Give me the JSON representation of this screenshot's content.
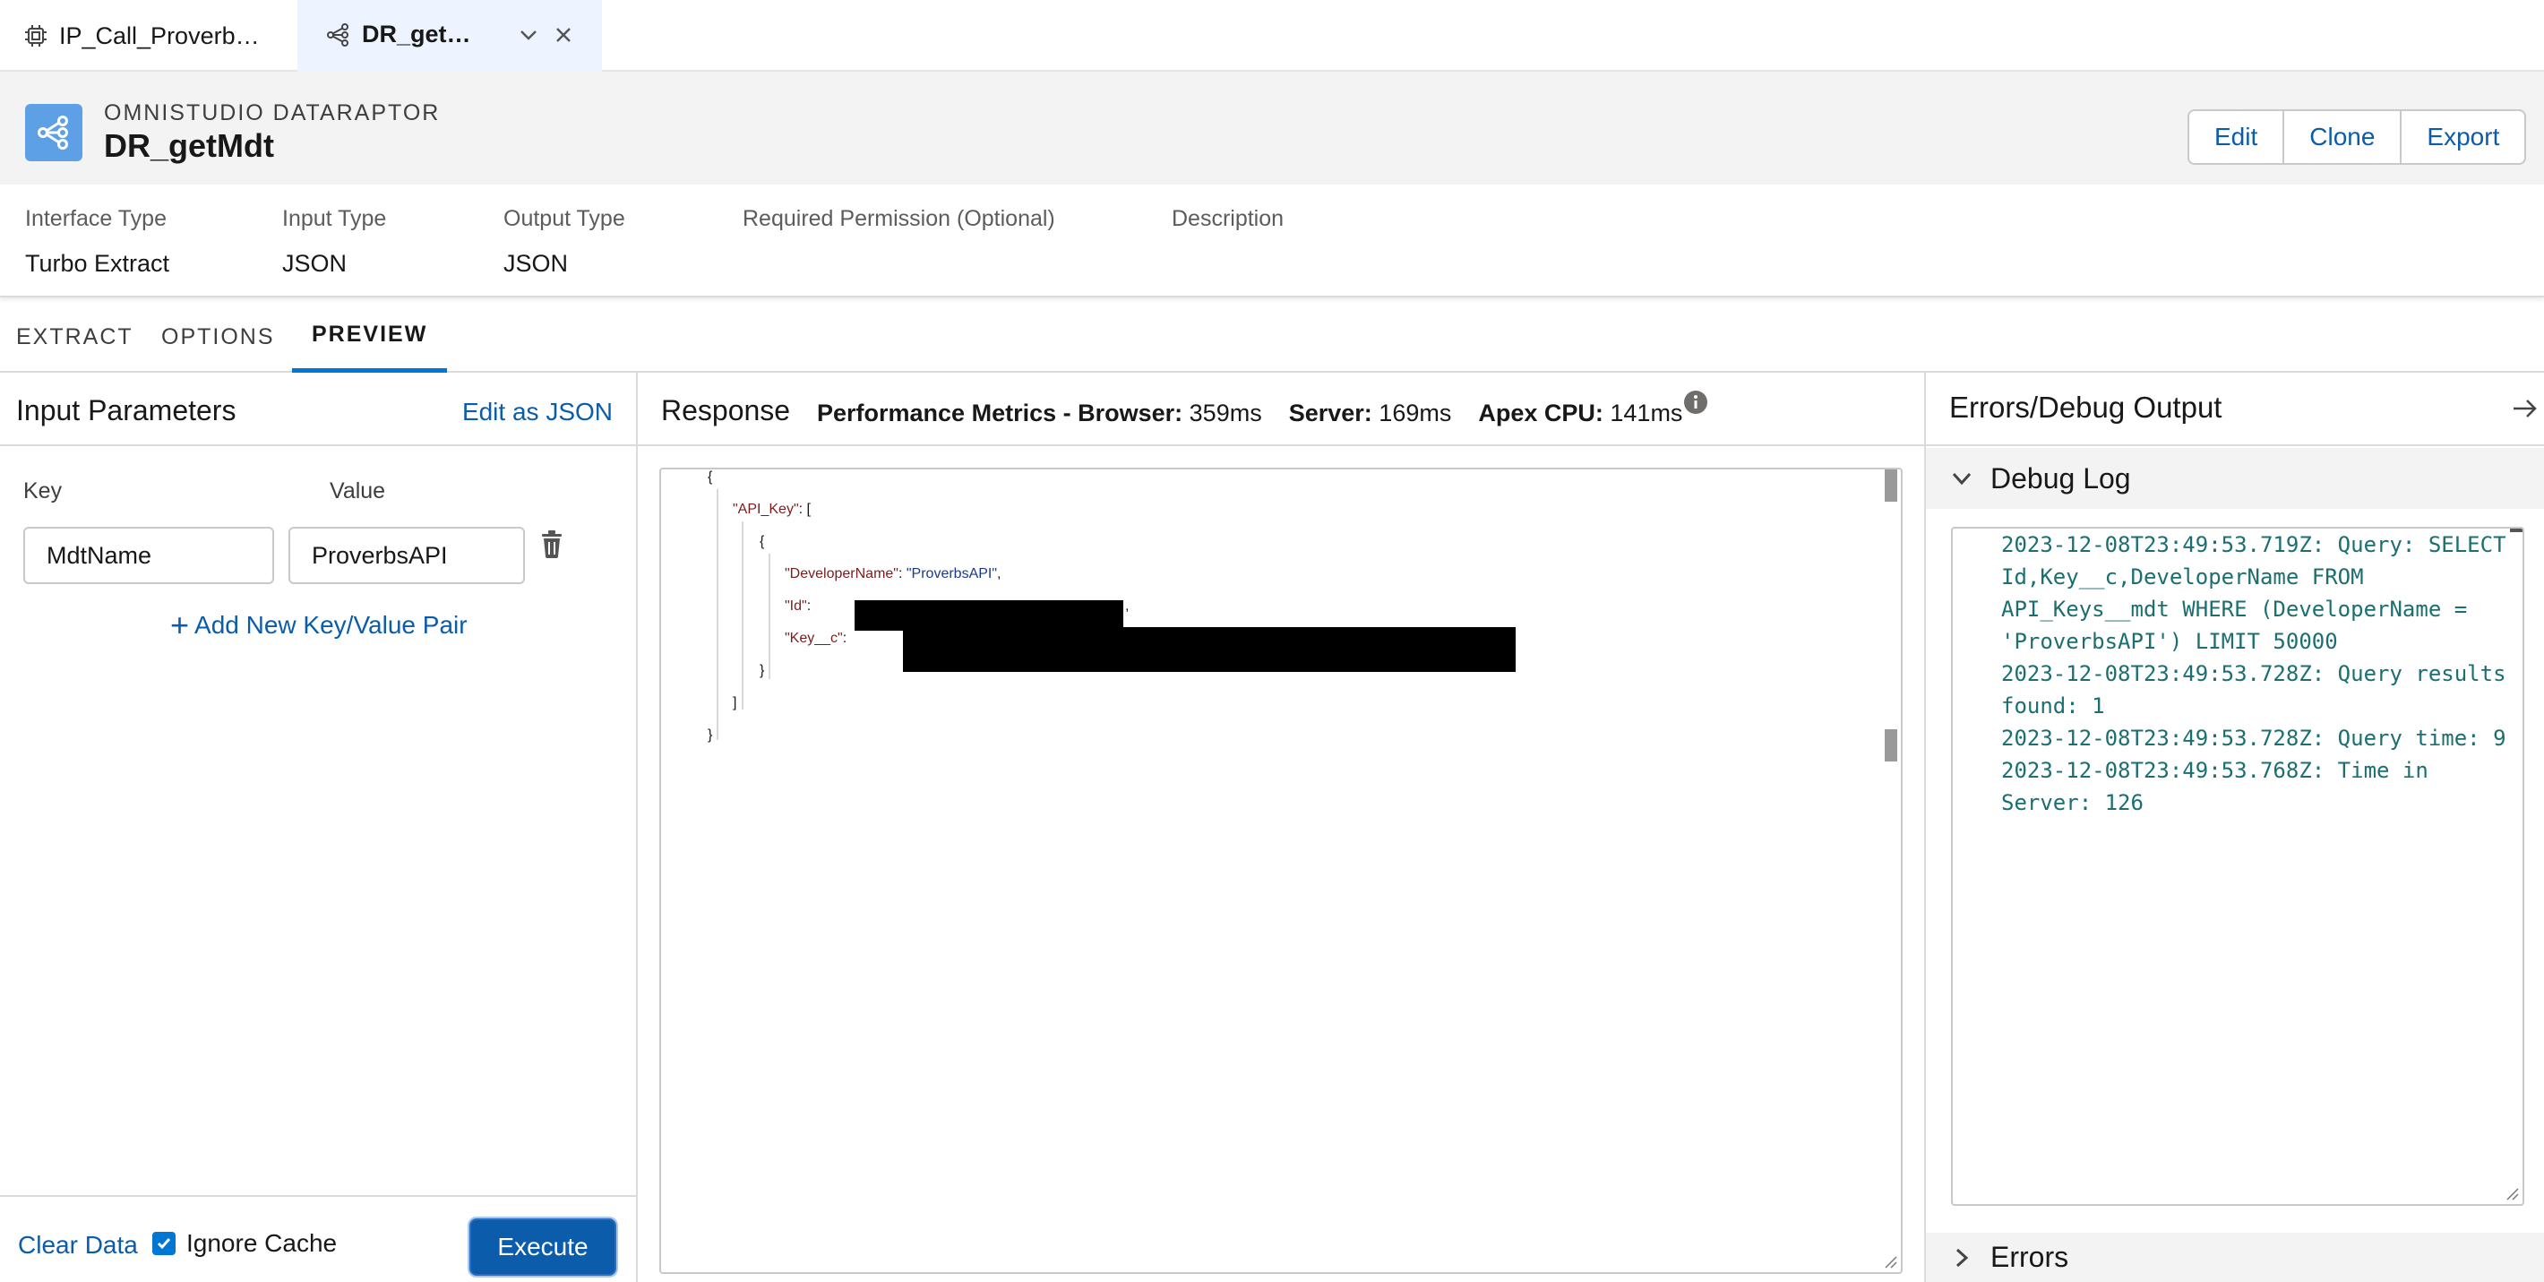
{
  "tabs": [
    {
      "label": "IP_Call_Proverb…",
      "icon": "chip-icon"
    },
    {
      "label": "DR_get…",
      "icon": "share-nodes-icon"
    }
  ],
  "record": {
    "kicker": "OMNISTUDIO DATARAPTOR",
    "title": "DR_getMdt",
    "actions": {
      "edit": "Edit",
      "clone": "Clone",
      "export": "Export"
    }
  },
  "fields": {
    "interface_type": {
      "label": "Interface Type",
      "value": "Turbo Extract"
    },
    "input_type": {
      "label": "Input Type",
      "value": "JSON"
    },
    "output_type": {
      "label": "Output Type",
      "value": "JSON"
    },
    "required_permission": {
      "label": "Required Permission (Optional)",
      "value": ""
    },
    "description": {
      "label": "Description",
      "value": ""
    }
  },
  "subtabs": {
    "extract": "EXTRACT",
    "options": "OPTIONS",
    "preview": "PREVIEW",
    "active": "PREVIEW"
  },
  "input_params": {
    "title": "Input Parameters",
    "edit_json": "Edit as JSON",
    "key_header": "Key",
    "value_header": "Value",
    "rows": [
      {
        "key": "MdtName",
        "value": "ProverbsAPI"
      }
    ],
    "add_pair": "Add New Key/Value Pair",
    "clear_data": "Clear Data",
    "ignore_cache_label": "Ignore Cache",
    "ignore_cache_checked": true,
    "execute": "Execute"
  },
  "response": {
    "title": "Response",
    "metrics_label": "Performance Metrics - Browser:",
    "browser_ms": "359ms",
    "server_label": "Server:",
    "server_ms": "169ms",
    "apex_label": "Apex CPU:",
    "apex_ms": "141ms",
    "json": {
      "open": "{",
      "api_key_key": "\"API_Key\"",
      "api_key_open": ": [",
      "obj_open": "{",
      "dev_name_key": "\"DeveloperName\"",
      "dev_name_val": "\"ProverbsAPI\"",
      "id_key": "\"Id\"",
      "key_c_key": "\"Key__c\"",
      "obj_close": "}",
      "arr_close": "]",
      "close": "}"
    }
  },
  "debug": {
    "title": "Errors/Debug Output",
    "debug_log_label": "Debug Log",
    "errors_label": "Errors",
    "log_lines": [
      "2023-12-08T23:49:53.719Z: Query: SELECT",
      "Id,Key__c,DeveloperName FROM",
      "API_Keys__mdt WHERE (DeveloperName =",
      "'ProverbsAPI') LIMIT 50000",
      "2023-12-08T23:49:53.728Z: Query results",
      "found: 1",
      "2023-12-08T23:49:53.728Z: Query time: 9",
      "2023-12-08T23:49:53.768Z: Time in",
      "Server: 126"
    ]
  },
  "colors": {
    "brand_blue": "#0b5cab",
    "accent_blue": "#0176d3",
    "record_icon_bg": "#5ea0e6",
    "json_key": "#7a1d1d",
    "json_string": "#1a3a8c",
    "log_text": "#1b6f70"
  }
}
